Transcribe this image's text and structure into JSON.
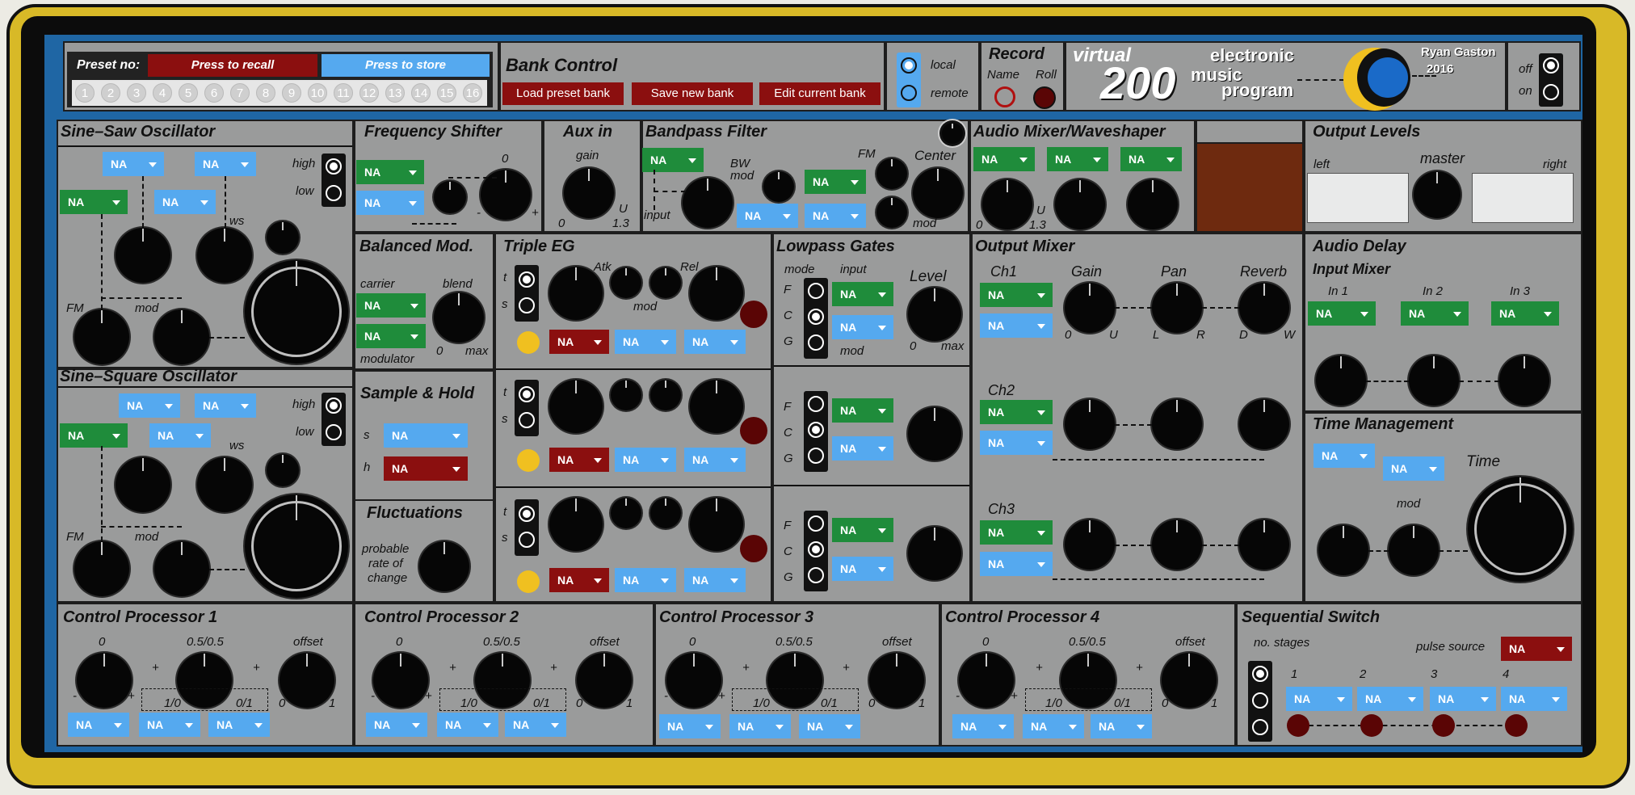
{
  "preset": {
    "label": "Preset no:",
    "recall": "Press to recall",
    "store": "Press to store",
    "numbers": [
      "1",
      "2",
      "3",
      "4",
      "5",
      "6",
      "7",
      "8",
      "9",
      "10",
      "11",
      "12",
      "13",
      "14",
      "15",
      "16"
    ]
  },
  "bank": {
    "title": "Bank Control",
    "load": "Load preset bank",
    "save": "Save new bank",
    "edit": "Edit current bank"
  },
  "mode": {
    "local": "local",
    "remote": "remote"
  },
  "record": {
    "title": "Record",
    "name": "Name",
    "roll": "Roll"
  },
  "logo": {
    "virtual": "virtual",
    "num": "200",
    "l1": "electronic",
    "l2": "music",
    "l3": "program",
    "author": "Ryan Gaston",
    "year": "2016"
  },
  "power": {
    "off": "off",
    "on": "on"
  },
  "dd": "NA",
  "sections": {
    "sinesaw": "Sine–Saw Oscillator",
    "freqshift": "Frequency Shifter",
    "auxin": "Aux in",
    "bandpass": "Bandpass Filter",
    "mixer": "Audio Mixer/Waveshaper",
    "outlevels": "Output Levels",
    "balmod": "Balanced Mod.",
    "tripleeg": "Triple EG",
    "lpg": "Lowpass Gates",
    "outmix": "Output Mixer",
    "audiodelay": "Audio Delay",
    "sinesq": "Sine–Square Oscillator",
    "sh": "Sample & Hold",
    "fluct": "Fluctuations",
    "time": "Time Management",
    "cp1": "Control Processor 1",
    "cp2": "Control Processor 2",
    "cp3": "Control Processor 3",
    "cp4": "Control Processor 4",
    "seqsw": "Sequential Switch"
  },
  "labels": {
    "high": "high",
    "low": "low",
    "fm": "FM",
    "mod": "mod",
    "ws": "ws",
    "zero": "0",
    "gain": "gain",
    "u": "U",
    "u13": "1.3",
    "bw": "BW",
    "center": "Center",
    "input": "input",
    "minus": "-",
    "plus": "+",
    "left": "left",
    "right": "right",
    "master": "master",
    "carrier": "carrier",
    "blend": "blend",
    "modulator": "modulator",
    "max": "max",
    "t": "t",
    "s": "s",
    "h": "h",
    "atk": "Atk",
    "rel": "Rel",
    "modeL": "mode",
    "F": "F",
    "C": "C",
    "G": "G",
    "level": "Level",
    "ch1": "Ch1",
    "ch2": "Ch2",
    "ch3": "Ch3",
    "gainC": "Gain",
    "pan": "Pan",
    "reverb": "Reverb",
    "L": "L",
    "R": "R",
    "D": "D",
    "W": "W",
    "inputMixer": "Input Mixer",
    "in1": "In 1",
    "in2": "In 2",
    "in3": "In 3",
    "timeL": "Time",
    "probable": "probable",
    "rateof": "rate of",
    "change": "change",
    "half": "0.5/0.5",
    "offset": "offset",
    "one": "1",
    "p10": "1/0",
    "p01": "0/1",
    "stages": "no. stages",
    "pulse": "pulse source",
    "s1": "1",
    "s2": "2",
    "s3": "3",
    "s4": "4"
  },
  "colors": {
    "panel": "#9a9b9b",
    "blue": "#55a9ef",
    "green": "#1f8c3b",
    "red": "#8b0f0f",
    "frame": "#d8b927",
    "trim": "#1f66a4"
  }
}
